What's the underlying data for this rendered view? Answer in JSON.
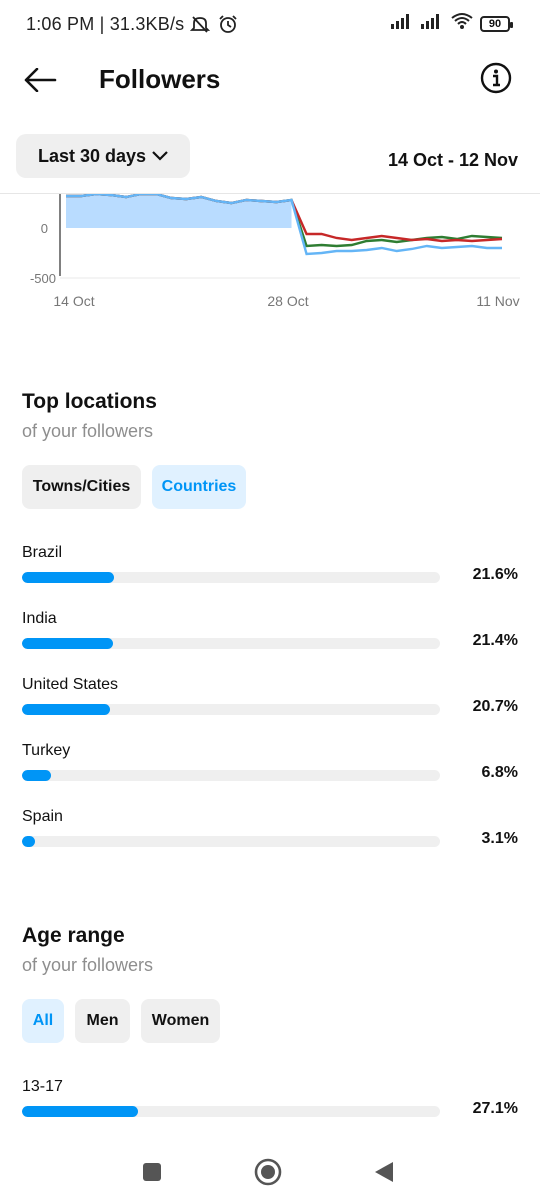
{
  "status_bar": {
    "text": "1:06 PM | 31.3KB/s",
    "battery": "90"
  },
  "header": {
    "title": "Followers"
  },
  "date_filter": {
    "period_label": "Last 30 days",
    "range": "14 Oct - 12 Nov"
  },
  "chart_data": {
    "type": "line",
    "ylabels": [
      "0",
      "-500"
    ],
    "xlabels": [
      "14 Oct",
      "28 Oct",
      "11 Nov"
    ],
    "series": [
      {
        "color": "#2e7d32",
        "values": [
          70,
          70,
          110,
          80,
          60,
          120,
          150,
          50,
          40,
          60,
          20,
          0,
          30,
          20,
          10,
          30,
          -180,
          -170,
          -180,
          -170,
          -130,
          -120,
          -140,
          -120,
          -100,
          -90,
          -110,
          -80,
          -90,
          -100
        ]
      },
      {
        "color": "#c62828",
        "values": [
          70,
          70,
          110,
          80,
          60,
          120,
          150,
          50,
          40,
          60,
          20,
          0,
          30,
          20,
          10,
          30,
          -60,
          -60,
          -100,
          -120,
          -100,
          -80,
          -100,
          -120,
          -110,
          -130,
          -120,
          -130,
          -120,
          -110
        ]
      },
      {
        "color": "#64b5f6",
        "values": [
          70,
          70,
          110,
          80,
          60,
          120,
          150,
          50,
          40,
          60,
          20,
          0,
          30,
          20,
          10,
          30,
          -260,
          -250,
          -230,
          -230,
          -220,
          -200,
          -230,
          -210,
          -180,
          -200,
          -190,
          -180,
          -200,
          -200
        ]
      }
    ]
  },
  "top_locations": {
    "title": "Top locations",
    "subtitle": "of your followers",
    "chips": [
      "Towns/Cities",
      "Countries"
    ],
    "active_chip": "Countries",
    "items": [
      {
        "label": "Brazil",
        "pct": "21.6%",
        "fraction": 0.216
      },
      {
        "label": "India",
        "pct": "21.4%",
        "fraction": 0.214
      },
      {
        "label": "United States",
        "pct": "20.7%",
        "fraction": 0.207
      },
      {
        "label": "Turkey",
        "pct": "6.8%",
        "fraction": 0.068
      },
      {
        "label": "Spain",
        "pct": "3.1%",
        "fraction": 0.031
      }
    ]
  },
  "age_range": {
    "title": "Age range",
    "subtitle": "of your followers",
    "chips": [
      "All",
      "Men",
      "Women"
    ],
    "active_chip": "All",
    "items": [
      {
        "label": "13-17",
        "pct": "27.1%",
        "fraction": 0.271
      }
    ]
  },
  "colors": {
    "accent": "#0095f6",
    "chip_active_bg": "#e0f1ff",
    "track": "#efefef"
  }
}
